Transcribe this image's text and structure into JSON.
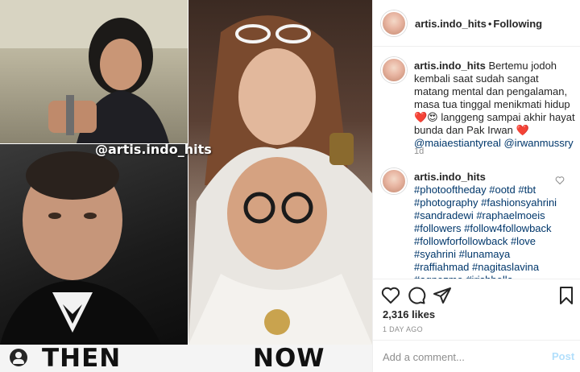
{
  "photo": {
    "watermark": "@artis.indo_hits",
    "caption_left": "THEN",
    "caption_right": "NOW",
    "user_tag_icon": "user-tag-icon"
  },
  "header": {
    "username": "artis.indo_hits",
    "separator": "•",
    "follow_status": "Following"
  },
  "caption": {
    "username": "artis.indo_hits",
    "text": "Bertemu jodoh kembali saat sudah sangat matang mental dan pengalaman, masa tua tinggal menikmati hidup ",
    "emojis": "❤️😍",
    "text2": " langgeng sampai akhir hayat bunda dan Pak Irwan ",
    "heart": "❤️",
    "mention1": "@maiaestiantyreal",
    "mention2": "@irwanmussry",
    "time": "1d"
  },
  "comment2": {
    "username": "artis.indo_hits",
    "hashtags": "#photooftheday #ootd #tbt #photography #fashionsyahrini #sandradewi #raphaelmoeis #followers #follow4followback #followforfollowback #love #syahrini #lunamaya #raffiahmad #nagitaslavina #agnezmo #irishbella #ammarzoni #prillylatuconsina #raisa"
  },
  "actions": {
    "like_icon": "heart-icon",
    "comment_icon": "comment-icon",
    "share_icon": "share-icon",
    "save_icon": "bookmark-icon",
    "likes": "2,316 likes",
    "time_ago": "1 DAY AGO"
  },
  "add_comment": {
    "placeholder": "Add a comment...",
    "post_label": "Post"
  },
  "colors": {
    "link": "#00376b",
    "muted": "#8e8e8e",
    "post_disabled": "#b2dffc"
  }
}
